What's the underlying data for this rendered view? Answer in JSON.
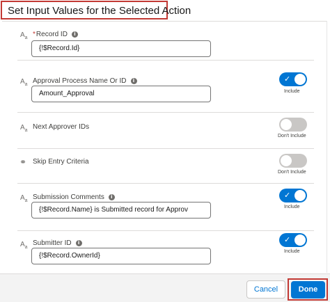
{
  "header": {
    "title": "Set Input Values for the Selected Action"
  },
  "fields": [
    {
      "label": "Record ID",
      "required_marker": "*",
      "value": "{!$Record.Id}"
    },
    {
      "label": "Approval Process Name Or ID",
      "value": "Amount_Approval",
      "toggle_label": "Include"
    },
    {
      "label": "Next Approver IDs",
      "toggle_label": "Don't Include"
    },
    {
      "label": "Skip Entry Criteria",
      "toggle_label": "Don't Include"
    },
    {
      "label": "Submission Comments",
      "value": "{!$Record.Name} is Submitted record for Approv",
      "toggle_label": "Include"
    },
    {
      "label": "Submitter ID",
      "value": "{!$Record.OwnerId}",
      "toggle_label": "Include"
    }
  ],
  "icons": {
    "text_type": "AA",
    "boolean_type": "OO",
    "info": "i",
    "check": "✓"
  },
  "footer": {
    "cancel_label": "Cancel",
    "done_label": "Done"
  },
  "colors": {
    "accent": "#0176d3",
    "highlight": "#c23934",
    "toggle_off": "#c9c7c5"
  },
  "toggles": {
    "approval": true,
    "next_approver": false,
    "skip_entry": false,
    "comments": true,
    "submitter": true
  }
}
